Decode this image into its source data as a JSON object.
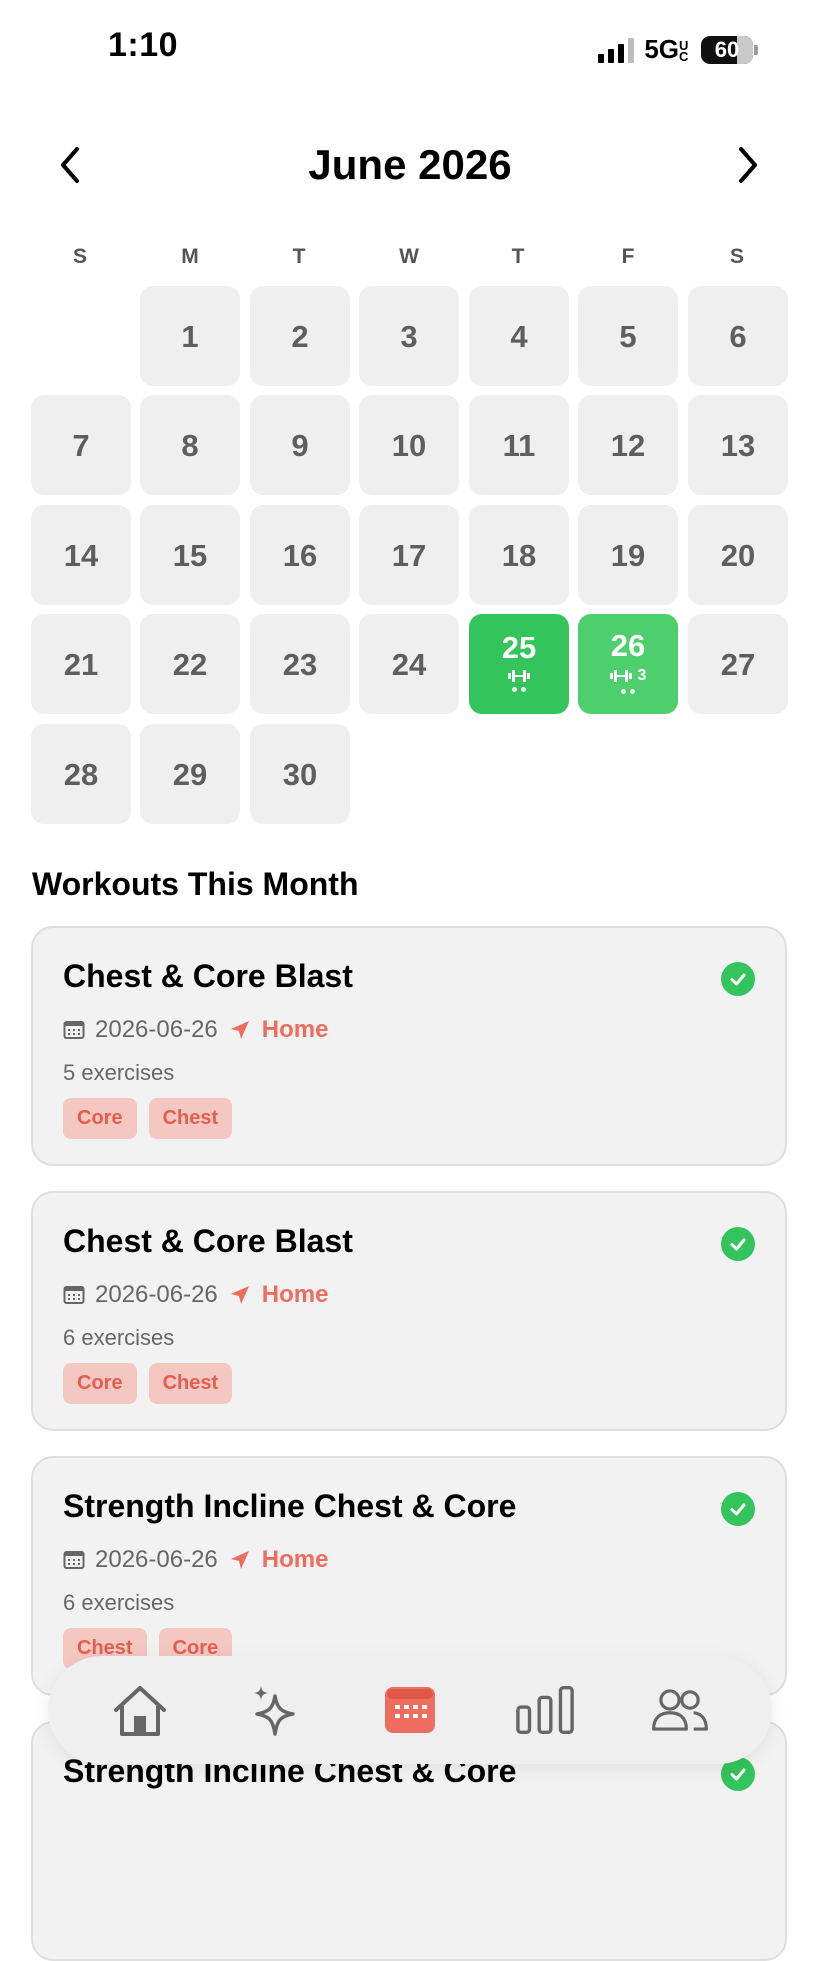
{
  "status_bar": {
    "time": "1:10",
    "network": "5G",
    "network_suffix": "UC",
    "battery": "60"
  },
  "header": {
    "month_title": "June 2026",
    "prev_icon": "chevron-left-icon",
    "next_icon": "chevron-right-icon"
  },
  "weekdays": [
    "S",
    "M",
    "T",
    "W",
    "T",
    "F",
    "S"
  ],
  "calendar": {
    "days": [
      "1",
      "2",
      "3",
      "4",
      "5",
      "6",
      "7",
      "8",
      "9",
      "10",
      "11",
      "12",
      "13",
      "14",
      "15",
      "16",
      "17",
      "18",
      "19",
      "20",
      "21",
      "22",
      "23",
      "24",
      "25",
      "26",
      "27",
      "28",
      "29",
      "30"
    ],
    "workout_days": {
      "25": {
        "icon": "dumbbell-icon",
        "count": "",
        "dots": 2
      },
      "26": {
        "icon": "dumbbell-icon",
        "count": "3",
        "dots": 2
      }
    },
    "workout_color": "#33c55b"
  },
  "section_title": "Workouts This Month",
  "workouts": [
    {
      "title": "Chest & Core Blast",
      "date": "2026-06-26",
      "location": "Home",
      "exercises": "5 exercises",
      "tags": [
        "Core",
        "Chest"
      ],
      "completed": true
    },
    {
      "title": "Chest & Core Blast",
      "date": "2026-06-26",
      "location": "Home",
      "exercises": "6 exercises",
      "tags": [
        "Core",
        "Chest"
      ],
      "completed": true
    },
    {
      "title": "Strength Incline Chest & Core",
      "date": "2026-06-26",
      "location": "Home",
      "exercises": "6 exercises",
      "tags": [
        "Chest",
        "Core"
      ],
      "completed": true
    },
    {
      "title": "Strength Incline Chest & Core",
      "date": "",
      "location": "",
      "exercises": "",
      "tags": [],
      "completed": true
    }
  ],
  "tabbar": {
    "tabs": [
      {
        "icon": "home-icon",
        "active": false
      },
      {
        "icon": "sparkle-icon",
        "active": false
      },
      {
        "icon": "calendar-icon",
        "active": true
      },
      {
        "icon": "stats-icon",
        "active": false
      },
      {
        "icon": "people-icon",
        "active": false
      }
    ]
  },
  "colors": {
    "accent": "#ee6d5f",
    "success": "#33c55b",
    "tag_bg": "#f5c7c1",
    "tile_bg": "#efefef"
  }
}
